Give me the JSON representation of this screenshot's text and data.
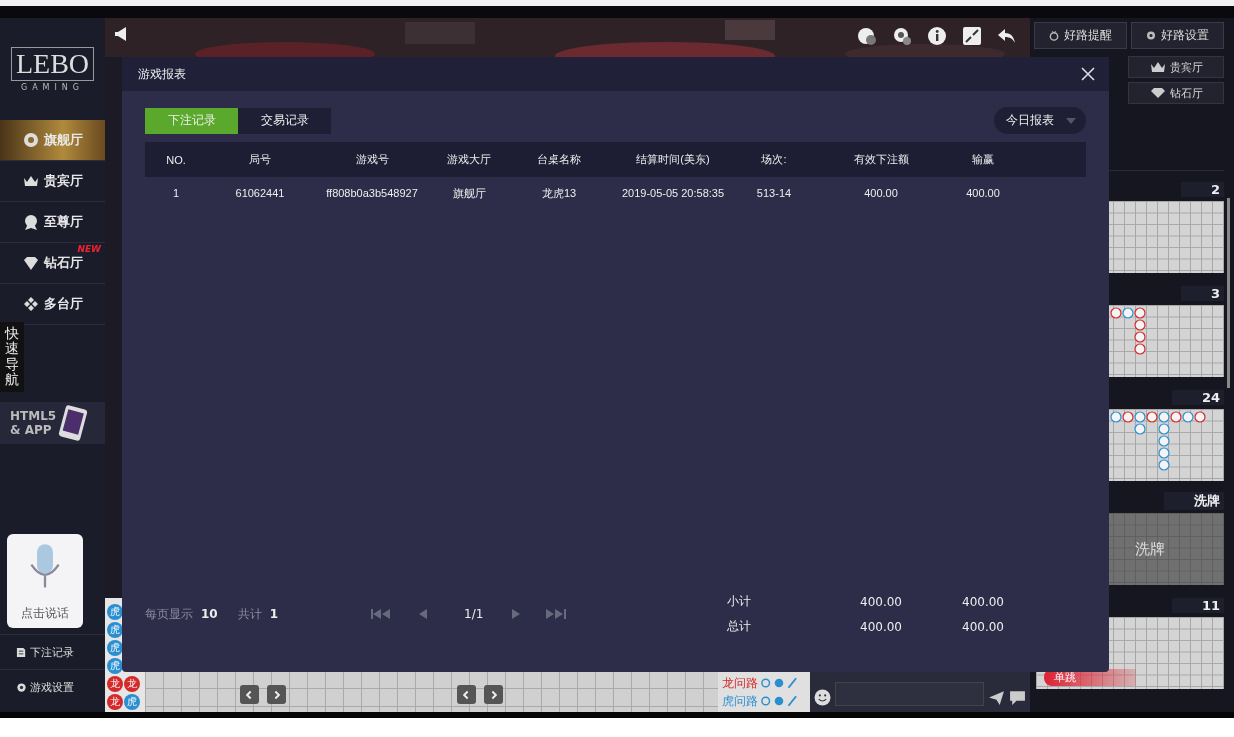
{
  "sidebar": {
    "logo": "LEBO",
    "logo_sub": "GAMING",
    "items": [
      {
        "label": "旗舰厅",
        "selected": true
      },
      {
        "label": "贵宾厅",
        "selected": false
      },
      {
        "label": "至尊厅",
        "selected": false
      },
      {
        "label": "钻石厅",
        "selected": false,
        "badge": "NEW"
      },
      {
        "label": "多台厅",
        "selected": false
      }
    ],
    "quick_nav": "快速导航",
    "promo": [
      "HTML5",
      "& APP"
    ],
    "voice_button": "点击说话",
    "bottom_items": [
      "下注记录",
      "游戏设置"
    ]
  },
  "right_panel": {
    "top_buttons": [
      "好路提醒",
      "好路设置"
    ],
    "hall_buttons": [
      "贵宾厅",
      "钻石厅"
    ],
    "road_cards": [
      {
        "label": "2",
        "kind": "empty"
      },
      {
        "label": "3",
        "kind": "beads"
      },
      {
        "label": "24",
        "kind": "beads"
      },
      {
        "label": "洗牌",
        "kind": "shuffle",
        "overlay": "洗牌"
      },
      {
        "label": "11",
        "kind": "empty",
        "tag": "单跳"
      }
    ]
  },
  "bottom_bar": {
    "bead_columns": [
      [
        {
          "label": "虎",
          "color": "#2a8fd0"
        },
        {
          "label": "虎",
          "color": "#2a8fd0"
        },
        {
          "label": "虎",
          "color": "#2a8fd0"
        },
        {
          "label": "虎",
          "color": "#2a8fd0"
        },
        {
          "label": "龙",
          "color": "#d42a2a"
        },
        {
          "label": "龙",
          "color": "#d42a2a"
        }
      ],
      [
        {
          "label": "龙",
          "color": "#d42a2a"
        },
        {
          "label": "虎",
          "color": "#2a8fd0"
        }
      ]
    ],
    "ask_road": [
      {
        "label": "龙问路",
        "kind": "dragon"
      },
      {
        "label": "虎问路",
        "kind": "tiger"
      }
    ]
  },
  "modal": {
    "title": "游戏报表",
    "tabs": [
      {
        "label": "下注记录",
        "selected": true
      },
      {
        "label": "交易记录",
        "selected": false
      }
    ],
    "dropdown": "今日报表",
    "columns": [
      "NO.",
      "局号",
      "游戏号",
      "游戏大厅",
      "台桌名称",
      "结算时间(美东)",
      "场次:",
      "有效下注额",
      "输赢"
    ],
    "rows": [
      [
        "1",
        "61062441",
        "ff808b0a3b548927",
        "旗舰厅",
        "龙虎13",
        "2019-05-05 20:58:35",
        "513-14",
        "400.00",
        "400.00"
      ]
    ],
    "per_page_label": "每页显示",
    "per_page": "10",
    "total_label": "共计",
    "total": "1",
    "page": "1/1",
    "sums": [
      {
        "label": "小计",
        "values": [
          "400.00",
          "400.00"
        ]
      },
      {
        "label": "总计",
        "values": [
          "400.00",
          "400.00"
        ]
      }
    ]
  }
}
